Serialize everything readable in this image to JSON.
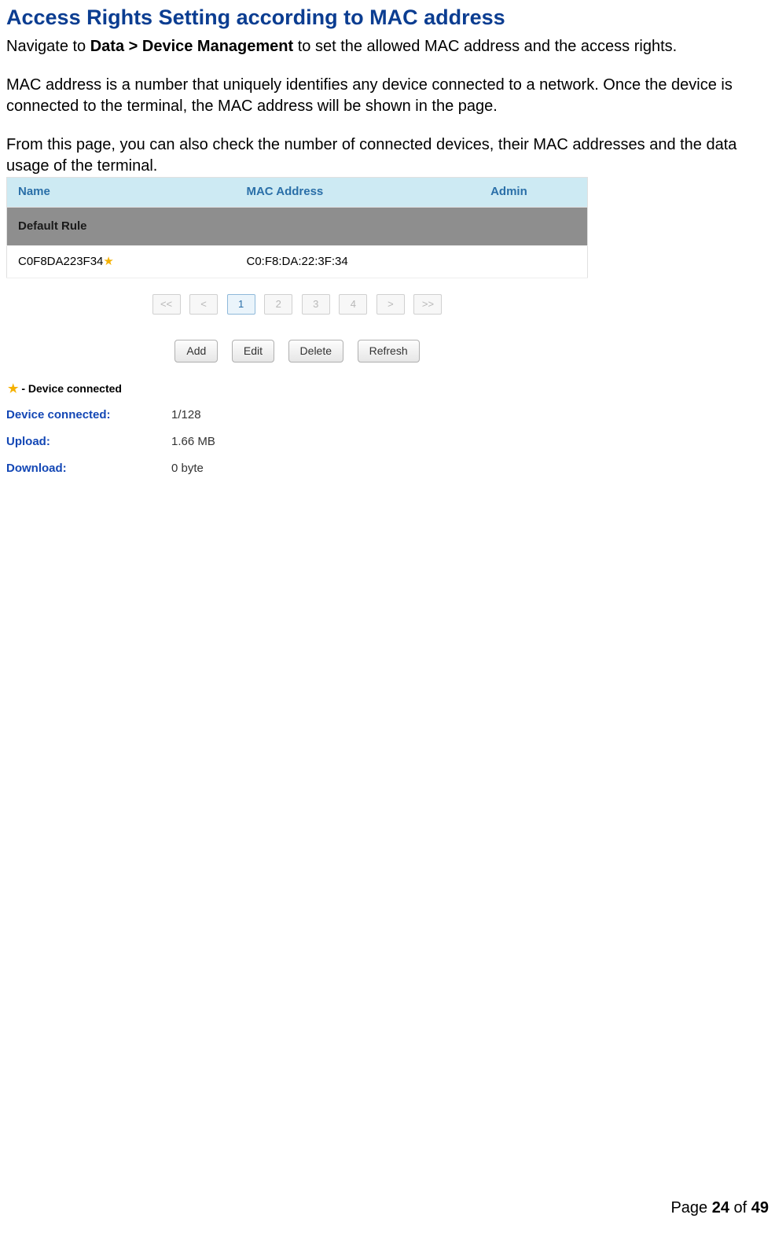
{
  "title": "Access Rights Setting according to MAC address",
  "paragraphs": {
    "p1_prefix": "Navigate to ",
    "p1_bold": "Data > Device Management",
    "p1_suffix": " to set the allowed MAC address and the access rights.",
    "p2": "MAC address is a number that uniquely identifies any device connected to a network. Once the device is connected to the terminal, the MAC address will be shown in the page.",
    "p3": "From this page, you can also check the number of connected devices, their MAC addresses and the data usage of the terminal."
  },
  "table": {
    "headers": {
      "name": "Name",
      "mac": "MAC Address",
      "admin": "Admin"
    },
    "default_rule_label": "Default Rule",
    "rows": [
      {
        "name": "C0F8DA223F34",
        "starred": true,
        "mac": "C0:F8:DA:22:3F:34",
        "admin": ""
      }
    ]
  },
  "pagination": {
    "first": "<<",
    "prev": "<",
    "pages": [
      "1",
      "2",
      "3",
      "4"
    ],
    "active_index": 0,
    "next": ">",
    "last": ">>"
  },
  "actions": {
    "add": "Add",
    "edit": "Edit",
    "delete": "Delete",
    "refresh": "Refresh"
  },
  "legend_text": " - Device connected",
  "stats": {
    "device_connected": {
      "label": "Device connected:",
      "value": "1/128"
    },
    "upload": {
      "label": "Upload:",
      "value": "1.66 MB"
    },
    "download": {
      "label": "Download:",
      "value": "0 byte"
    }
  },
  "footer": {
    "prefix": "Page ",
    "current": "24",
    "middle": " of ",
    "total": "49"
  }
}
